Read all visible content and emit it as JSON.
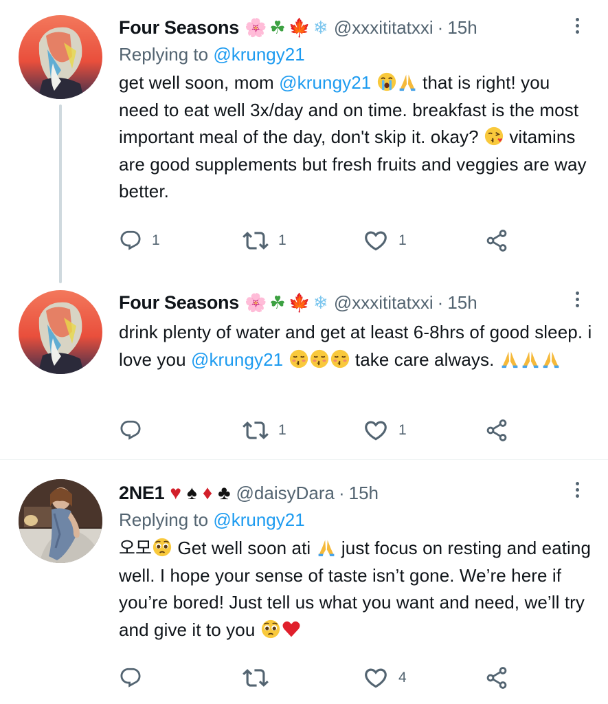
{
  "tweets": [
    {
      "name": "Four Seasons",
      "badges": [
        "🌸",
        "☘",
        "🍁",
        "❄"
      ],
      "handle": "@xxxititatxxi",
      "dot": "·",
      "time": "15h",
      "replying_prefix": "Replying to ",
      "replying_to": "@krungy21",
      "body": {
        "t1": "get well soon, mom ",
        "mention": "@krungy21",
        "t2": " that is right! you need to eat well 3x/day and on time. breakfast is the most important meal of the day, don't skip it. okay? ",
        "t3": " vitamins are good supplements but fresh fruits and veggies are way better."
      },
      "replies": "1",
      "retweets": "1",
      "likes": "1"
    },
    {
      "name": "Four Seasons",
      "badges": [
        "🌸",
        "☘",
        "🍁",
        "❄"
      ],
      "handle": "@xxxititatxxi",
      "dot": "·",
      "time": "15h",
      "body": {
        "t1": "drink plenty of water and get at least 6-8hrs of good sleep. i love you ",
        "mention": "@krungy21",
        "t2": " take care always. "
      },
      "replies": "",
      "retweets": "1",
      "likes": "1"
    },
    {
      "name": "2NE1",
      "badges": [
        "♥",
        "♠",
        "♦",
        "♣"
      ],
      "handle": "@daisyDara",
      "dot": "·",
      "time": "15h",
      "replying_prefix": "Replying to ",
      "replying_to": "@krungy21",
      "body": {
        "t1": "오모",
        "t2": " Get well soon ati ",
        "t3": " just focus on resting and eating well. I hope your sense of taste isn’t gone. We’re here if you’re bored! Just tell us what you want and need, we’ll try and give it to you "
      },
      "replies": "",
      "retweets": "",
      "likes": "4"
    }
  ],
  "icons": {
    "reply": "reply-icon",
    "retweet": "retweet-icon",
    "like": "heart-icon",
    "share": "share-icon",
    "more": "more-options-icon"
  },
  "colors": {
    "mention": "#1d9bf0",
    "secondary": "#536471",
    "text": "#0f1419",
    "thread_line": "#cfd9de",
    "separator": "#eff3f4"
  }
}
